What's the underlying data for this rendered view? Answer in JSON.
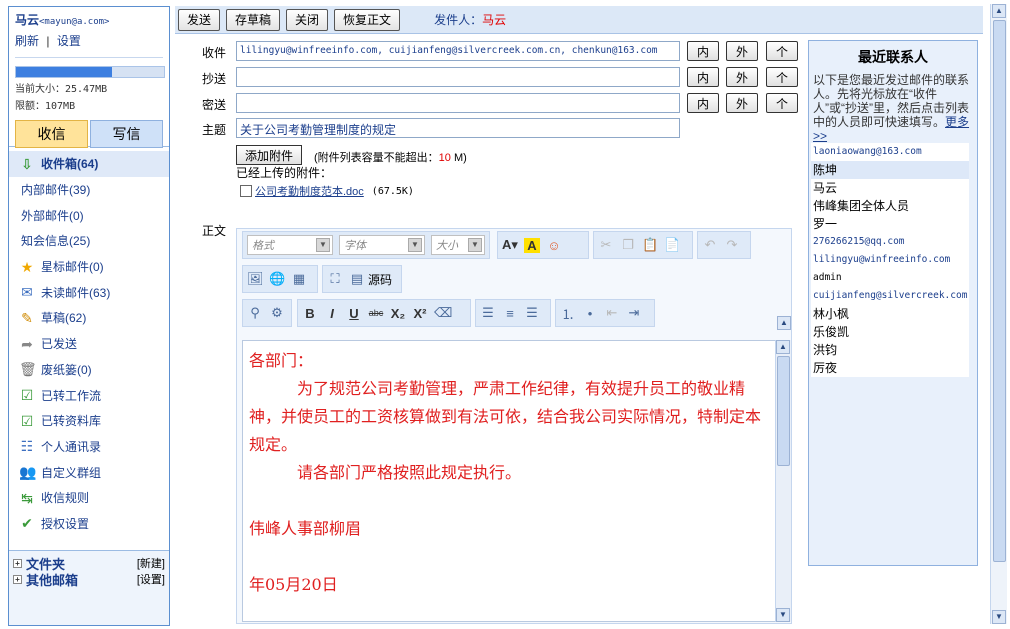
{
  "sidebar": {
    "user_name": "马云",
    "user_email": "<mayun@a.com>",
    "refresh_label": "刷新",
    "separator": "|",
    "settings_label": "设置",
    "quota_fraction": 0.65,
    "current_size": "当前大小：25.47MB",
    "limit": "限额：107MB",
    "receive_label": "收信",
    "write_label": "写信",
    "items": [
      {
        "label": "收件箱(64)",
        "icon": "inbox-icon"
      },
      {
        "label": "内部邮件(39)",
        "icon": ""
      },
      {
        "label": "外部邮件(0)",
        "icon": ""
      },
      {
        "label": "知会信息(25)",
        "icon": ""
      },
      {
        "label": "星标邮件(0)",
        "icon": "star-icon"
      },
      {
        "label": "未读邮件(63)",
        "icon": "unread-icon"
      },
      {
        "label": "草稿(62)",
        "icon": "draft-icon"
      },
      {
        "label": "已发送",
        "icon": "sent-icon"
      },
      {
        "label": "废纸篓(0)",
        "icon": "trash-icon"
      },
      {
        "label": "已转工作流",
        "icon": "workflow-icon"
      },
      {
        "label": "已转资料库",
        "icon": "library-icon"
      },
      {
        "label": "个人通讯录",
        "icon": "addressbook-icon"
      },
      {
        "label": "自定义群组",
        "icon": "group-icon"
      },
      {
        "label": "收信规则",
        "icon": "rules-icon"
      },
      {
        "label": "授权设置",
        "icon": "auth-icon"
      }
    ],
    "folders_label": "文件夹",
    "folders_action": "[新建]",
    "other_label": "其他邮箱",
    "other_action": "[设置]"
  },
  "toolbar": {
    "send": "发送",
    "save_draft": "存草稿",
    "close": "关闭",
    "restore": "恢复正文",
    "sender_label": "发件人：",
    "sender_name": "马云"
  },
  "compose": {
    "to_label": "收件",
    "cc_label": "抄送",
    "bcc_label": "密送",
    "subject_label": "主题",
    "body_label": "正文",
    "to_value": "lilingyu@winfreeinfo.com, cuijianfeng@silvercreek.com.cn, chenkun@163.com",
    "cc_value": "",
    "bcc_value": "",
    "subject_value": "关于公司考勤管理制度的规定",
    "btn_inner": "内",
    "btn_outer": "外",
    "btn_person": "个",
    "add_attachment": "添加附件",
    "attach_note_prefix": "(附件列表容量不能超出：",
    "attach_note_limit": "10",
    "attach_note_suffix": " M)",
    "uploaded_label": "已经上传的附件：",
    "file_name": "公司考勤制度范本.doc",
    "file_size": "(67.5K)"
  },
  "editor": {
    "format_placeholder": "格式",
    "font_placeholder": "字体",
    "size_placeholder": "大小",
    "source_label": "源码",
    "bold": "B",
    "italic": "I",
    "underline": "U",
    "strike": "abc",
    "sub": "X₂",
    "sup": "X²",
    "body_lines": [
      "各部门：",
      "为了规范公司考勤管理，严肃工作纪律，有效提升员工的敬业精神，并使员工的工资核算做到有法可依，结合我公司实际情况，特制定本规定。",
      "请各部门严格按照此规定执行。",
      "",
      "伟峰人事部柳眉",
      "",
      "年05月20日"
    ]
  },
  "contacts": {
    "title": "最近联系人",
    "description": "以下是您最近发过邮件的联系人。先将光标放在“收件人”或“抄送”里，然后点击列表中的人员即可快速填写。",
    "more": "更多>>",
    "list": [
      "laoniaowang@163.com",
      "陈坤",
      "马云",
      "伟峰集团全体人员",
      "罗一",
      "276266215@qq.com",
      "lilingyu@winfreeinfo.com",
      "admin",
      "cuijianfeng@silvercreek.com.cn",
      "林小枫",
      "乐俊凯",
      "洪钧",
      "厉夜"
    ]
  }
}
